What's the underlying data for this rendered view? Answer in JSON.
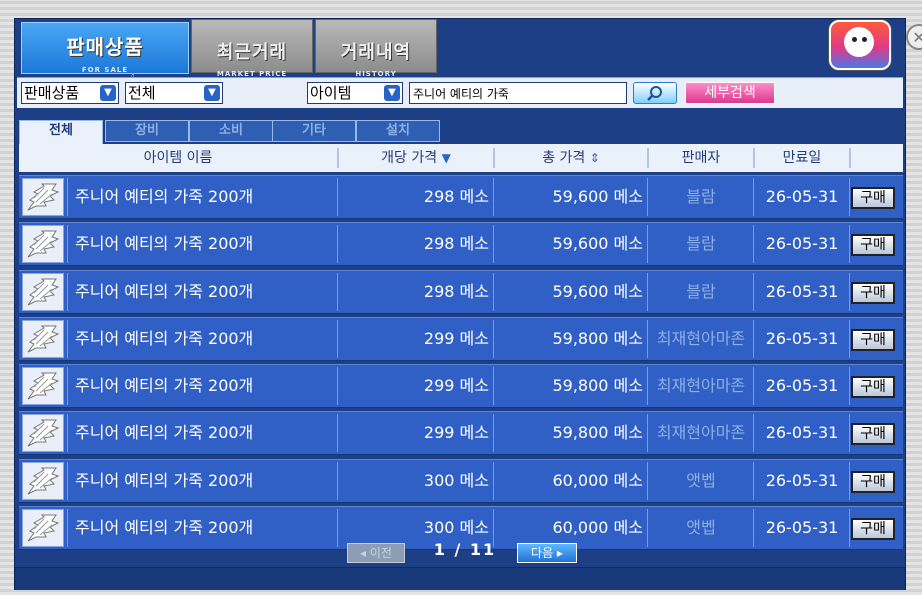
{
  "tabs": [
    {
      "label": "판매상품",
      "sub": "FOR SALE"
    },
    {
      "label": "최근거래",
      "sub": "MARKET PRICE"
    },
    {
      "label": "거래내역",
      "sub": "HISTORY"
    }
  ],
  "filters": {
    "category_value": "판매상품",
    "subcategory_value": "전체",
    "search_type_value": "아이템",
    "search_value": "주니어 예티의 가죽",
    "search_icon": "search-icon",
    "detail_search_label": "세부검색"
  },
  "category_tabs": [
    "전체",
    "장비",
    "소비",
    "기타",
    "설치"
  ],
  "columns": {
    "name": "아이템 이름",
    "unit_price": "개당 가격",
    "total_price": "총 가격",
    "seller": "판매자",
    "expiry": "만료일"
  },
  "rows": [
    {
      "name": "주니어 예티의 가죽 200개",
      "unit_price": "298 메소",
      "total_price": "59,600 메소",
      "seller": "블람",
      "expiry": "26-05-31",
      "buy": "구매"
    },
    {
      "name": "주니어 예티의 가죽 200개",
      "unit_price": "298 메소",
      "total_price": "59,600 메소",
      "seller": "블람",
      "expiry": "26-05-31",
      "buy": "구매"
    },
    {
      "name": "주니어 예티의 가죽 200개",
      "unit_price": "298 메소",
      "total_price": "59,600 메소",
      "seller": "블람",
      "expiry": "26-05-31",
      "buy": "구매"
    },
    {
      "name": "주니어 예티의 가죽 200개",
      "unit_price": "299 메소",
      "total_price": "59,800 메소",
      "seller": "최재현아마존",
      "expiry": "26-05-31",
      "buy": "구매"
    },
    {
      "name": "주니어 예티의 가죽 200개",
      "unit_price": "299 메소",
      "total_price": "59,800 메소",
      "seller": "최재현아마존",
      "expiry": "26-05-31",
      "buy": "구매"
    },
    {
      "name": "주니어 예티의 가죽 200개",
      "unit_price": "299 메소",
      "total_price": "59,800 메소",
      "seller": "최재현아마존",
      "expiry": "26-05-31",
      "buy": "구매"
    },
    {
      "name": "주니어 예티의 가죽 200개",
      "unit_price": "300 메소",
      "total_price": "60,000 메소",
      "seller": "앳벱",
      "expiry": "26-05-31",
      "buy": "구매"
    },
    {
      "name": "주니어 예티의 가죽 200개",
      "unit_price": "300 메소",
      "total_price": "60,000 메소",
      "seller": "앳벱",
      "expiry": "26-05-31",
      "buy": "구매"
    }
  ],
  "pagination": {
    "prev_label": "◂ 이전",
    "page_text": "1 / 11",
    "next_label": "다음 ▸"
  },
  "colors": {
    "panel": "#1d3f86",
    "row": "#3060c6",
    "seller_text": "#8fb0e4",
    "accent_pink": "#d93a8e"
  }
}
